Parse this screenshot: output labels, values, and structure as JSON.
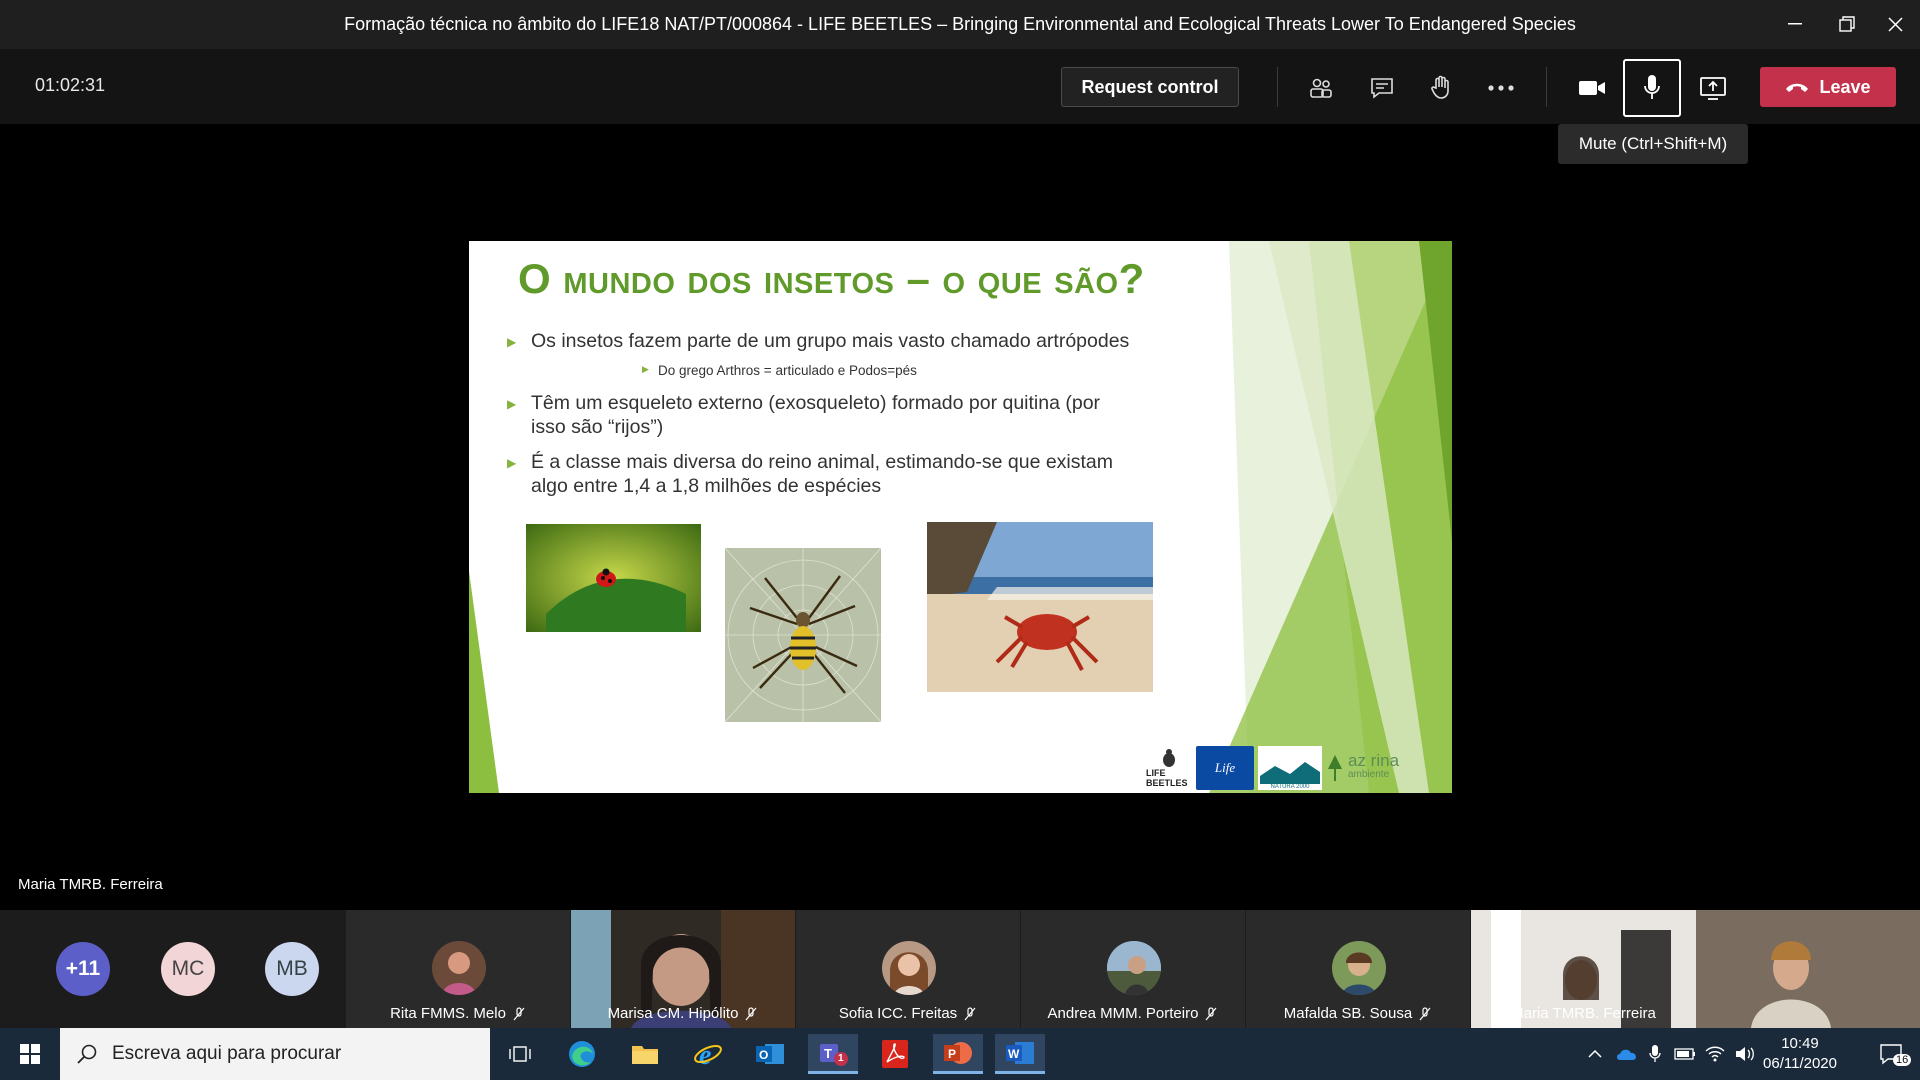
{
  "window": {
    "title": "Formação técnica no âmbito do LIFE18 NAT/PT/000864 - LIFE BEETLES – Bringing Environmental and Ecological Threats Lower To Endangered Species"
  },
  "call": {
    "timer": "01:02:31",
    "request_control": "Request control",
    "leave": "Leave",
    "tooltip": "Mute (Ctrl+Shift+M)",
    "tools": [
      "participants-icon",
      "chat-icon",
      "raise-hand-icon",
      "more-icon",
      "camera-icon",
      "microphone-icon",
      "share-icon"
    ]
  },
  "slide": {
    "title": "O mundo dos insetos – o que são?",
    "bullet1": "Os insetos fazem parte de um grupo mais vasto chamado artrópodes",
    "sub1": "Do grego Arthros = articulado e Podos=pés",
    "bullet2_line1": "Têm um esqueleto externo (exosqueleto) formado por quitina (por",
    "bullet2_line2": "isso são “rijos”)",
    "bullet3_line1": "É a classe mais diversa do reino animal, estimando-se que existam",
    "bullet3_line2": "algo entre 1,4 a 1,8 milhões de espécies",
    "logos": {
      "life_beetles": "LIFE BEETLES",
      "life": "Life",
      "natura": "NATURA 2000",
      "azorina": "az  rina",
      "ambiente": "ambiente"
    }
  },
  "presenter": "Maria TMRB. Ferreira",
  "participants": {
    "overflow": "+11",
    "mc": "MC",
    "mb": "MB",
    "tiles": [
      {
        "name": "Rita FMMS. Melo"
      },
      {
        "name": "Marisa CM. Hipólito"
      },
      {
        "name": "Sofia ICC. Freitas"
      },
      {
        "name": "Andrea MMM. Porteiro"
      },
      {
        "name": "Mafalda SB. Sousa"
      },
      {
        "name": "Maria TMRB. Ferreira"
      }
    ]
  },
  "taskbar": {
    "search_placeholder": "Escreva aqui para procurar",
    "time": "10:49",
    "date": "06/11/2020",
    "notifications": "16",
    "teams_badge": "1"
  },
  "colors": {
    "leave": "#c4314b",
    "slide_title": "#5f9a2a",
    "bullet": "#86b23e"
  }
}
